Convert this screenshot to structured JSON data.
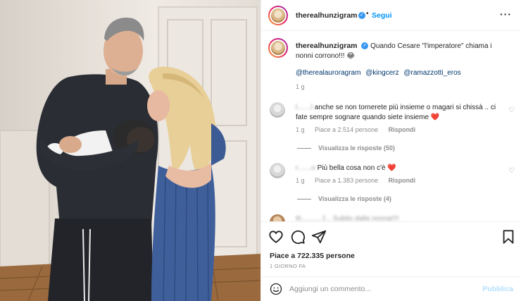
{
  "header": {
    "username": "therealhunzigram",
    "verified_icon": "verified-check-icon",
    "separator": "•",
    "follow_label": "Segui",
    "more_icon": "more-horizontal-icon"
  },
  "caption": {
    "username": "therealhunzigram",
    "text": "Quando Cesare \"l'imperatore\" chiama i nonni corrono!!! 😂",
    "tags": [
      "@therealauroragram",
      "@kingcerz",
      "@ramazzotti_eros"
    ],
    "time": "1 g"
  },
  "comments": [
    {
      "username": "l.......l",
      "text": "anche se non tornerete più insieme o magari si chissà .. ci fate sempre sognare quando siete insieme",
      "emoji": "❤️",
      "time": "1 g",
      "likes": "Piace a 2.514 persone",
      "reply_label": "Rispondi",
      "view_replies": "Visualizza le risposte (50)"
    },
    {
      "username": "r.......o",
      "text": "Più bella cosa non c'è",
      "emoji": "❤️",
      "time": "1 g",
      "likes": "Piace a 1.383 persone",
      "reply_label": "Rispondi",
      "view_replies": "Visualizza le risposte (4)"
    }
  ],
  "partial_comment": {
    "username": "th...........f...",
    "text": "Subito dalla nonna!!!!"
  },
  "actions": {
    "likes": "Piace a 722.335 persone",
    "posted": "1 GIORNO FA"
  },
  "comment_box": {
    "placeholder": "Aggiungi un commento...",
    "publish_label": "Pubblica"
  },
  "colors": {
    "accent": "#0095f6",
    "verified": "#3897f0",
    "heart": "#ed1b33",
    "publish_disabled": "#b2dffc"
  }
}
